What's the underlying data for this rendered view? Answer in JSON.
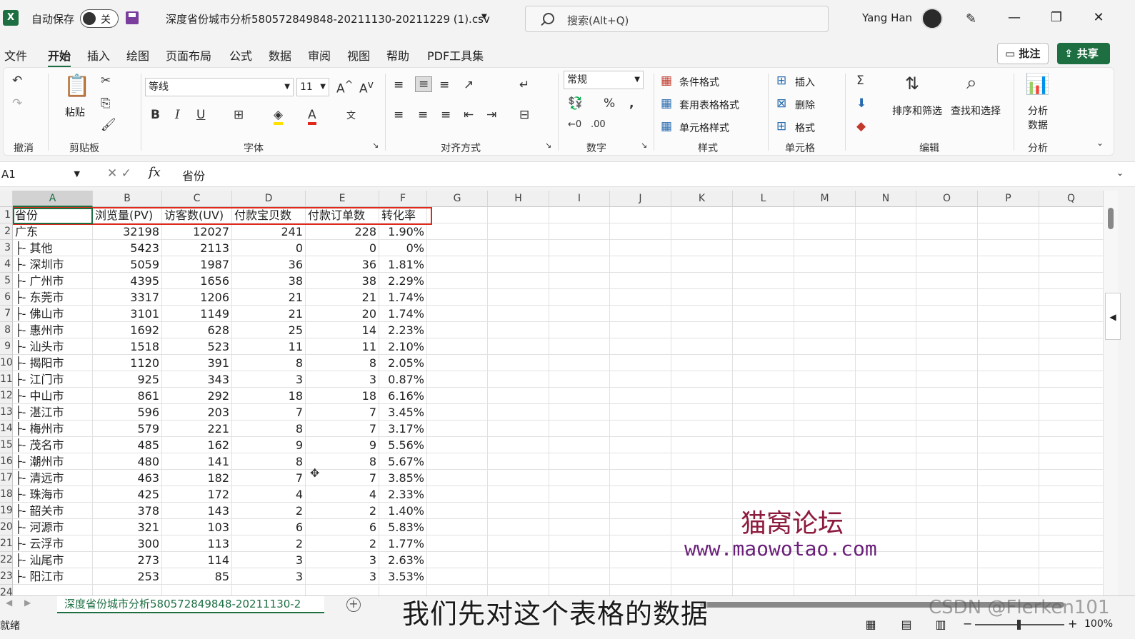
{
  "titlebar": {
    "app_icon": "X",
    "autosave_label": "自动保存",
    "autosave_state": "关",
    "file_name": "深度省份城市分析580572849848-20211130-20211229 (1).csv",
    "search_placeholder": "搜索(Alt+Q)",
    "user_name": "Yang Han",
    "minimize": "—",
    "restore": "❐",
    "close": "✕"
  },
  "menu": {
    "items": [
      "文件",
      "开始",
      "插入",
      "绘图",
      "页面布局",
      "公式",
      "数据",
      "审阅",
      "视图",
      "帮助",
      "PDF工具集"
    ],
    "active": "开始",
    "comment_label": "批注",
    "share_label": "共享"
  },
  "ribbon": {
    "undo_group": "撤消",
    "clipboard_group": "剪贴板",
    "paste_label": "粘贴",
    "font_group": "字体",
    "font_name": "等线",
    "font_size": "11",
    "align_group": "对齐方式",
    "number_group": "数字",
    "number_format": "常规",
    "styles_group": "样式",
    "conditional_format": "条件格式",
    "table_format": "套用表格格式",
    "cell_styles": "单元格样式",
    "cells_group": "单元格",
    "insert": "插入",
    "delete": "删除",
    "format": "格式",
    "edit_group": "编辑",
    "sort_filter": "排序和筛选",
    "find_select": "查找和选择",
    "analysis_group": "分析",
    "analyze_data_1": "分析",
    "analyze_data_2": "数据"
  },
  "formula_bar": {
    "name_box": "A1",
    "content": "省份"
  },
  "columns": [
    "A",
    "B",
    "C",
    "D",
    "E",
    "F",
    "G",
    "H",
    "I",
    "J",
    "K",
    "L",
    "M",
    "N",
    "O",
    "P",
    "Q"
  ],
  "row_numbers": [
    "1",
    "2",
    "3",
    "4",
    "5",
    "6",
    "7",
    "8",
    "9",
    "10",
    "11",
    "12",
    "13",
    "14",
    "15",
    "16",
    "17",
    "18",
    "19",
    "20",
    "21",
    "22",
    "23",
    "24"
  ],
  "sheet": {
    "header": [
      "省份",
      "浏览量(PV)",
      "访客数(UV)",
      "付款宝贝数",
      "付款订单数",
      "转化率"
    ],
    "rows": [
      [
        "广东",
        "32198",
        "12027",
        "241",
        "228",
        "1.90%"
      ],
      [
        "├- 其他",
        "5423",
        "2113",
        "0",
        "0",
        "0%"
      ],
      [
        "├- 深圳市",
        "5059",
        "1987",
        "36",
        "36",
        "1.81%"
      ],
      [
        "├- 广州市",
        "4395",
        "1656",
        "38",
        "38",
        "2.29%"
      ],
      [
        "├- 东莞市",
        "3317",
        "1206",
        "21",
        "21",
        "1.74%"
      ],
      [
        "├- 佛山市",
        "3101",
        "1149",
        "21",
        "20",
        "1.74%"
      ],
      [
        "├- 惠州市",
        "1692",
        "628",
        "25",
        "14",
        "2.23%"
      ],
      [
        "├- 汕头市",
        "1518",
        "523",
        "11",
        "11",
        "2.10%"
      ],
      [
        "├- 揭阳市",
        "1120",
        "391",
        "8",
        "8",
        "2.05%"
      ],
      [
        "├- 江门市",
        "925",
        "343",
        "3",
        "3",
        "0.87%"
      ],
      [
        "├- 中山市",
        "861",
        "292",
        "18",
        "18",
        "6.16%"
      ],
      [
        "├- 湛江市",
        "596",
        "203",
        "7",
        "7",
        "3.45%"
      ],
      [
        "├- 梅州市",
        "579",
        "221",
        "8",
        "7",
        "3.17%"
      ],
      [
        "├- 茂名市",
        "485",
        "162",
        "9",
        "9",
        "5.56%"
      ],
      [
        "├- 潮州市",
        "480",
        "141",
        "8",
        "8",
        "5.67%"
      ],
      [
        "├- 清远市",
        "463",
        "182",
        "7",
        "7",
        "3.85%"
      ],
      [
        "├- 珠海市",
        "425",
        "172",
        "4",
        "4",
        "2.33%"
      ],
      [
        "├- 韶关市",
        "378",
        "143",
        "2",
        "2",
        "1.40%"
      ],
      [
        "├- 河源市",
        "321",
        "103",
        "6",
        "6",
        "5.83%"
      ],
      [
        "├- 云浮市",
        "300",
        "113",
        "2",
        "2",
        "1.77%"
      ],
      [
        "├- 汕尾市",
        "273",
        "114",
        "3",
        "3",
        "2.63%"
      ],
      [
        "├- 阳江市",
        "253",
        "85",
        "3",
        "3",
        "3.53%"
      ]
    ]
  },
  "watermark": {
    "line1": "猫窝论坛",
    "line2": "www.maowotao.com"
  },
  "sheet_tab": "深度省份城市分析580572849848-20211130-2",
  "status": {
    "ready": "就绪",
    "zoom": "100%"
  },
  "video_subtitle": "我们先对这个表格的数据",
  "credit": "CSDN @Flerken101",
  "colors": {
    "excel_green": "#1d6f42",
    "highlight_red": "#e0281b"
  }
}
